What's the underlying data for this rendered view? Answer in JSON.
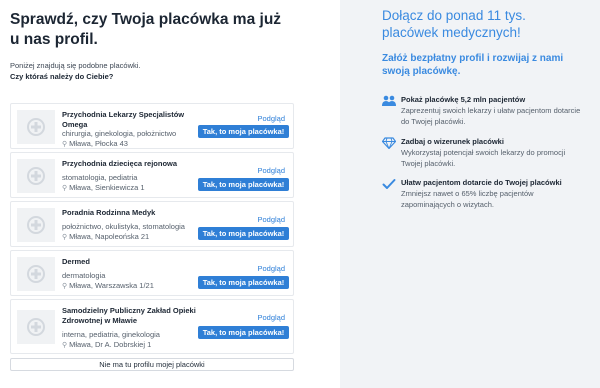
{
  "heading": "Sprawdź, czy Twoja placówka ma już u nas profil.",
  "intro": "Poniżej znajdują się podobne placówki.",
  "question": "Czy któraś należy do Ciebie?",
  "preview_label": "Podgląd",
  "claim_label": "Tak, to moja placówka!",
  "clinics": [
    {
      "name": "Przychodnia Lekarzy Specjalistów Omega",
      "specialties": "chirurgia, ginekologia, położnictwo",
      "address": "Mława, Płocka 43"
    },
    {
      "name": "Przychodnia dziecięca rejonowa",
      "specialties": "stomatologia, pediatria",
      "address": "Mława, Sienkiewicza 1"
    },
    {
      "name": "Poradnia Rodzinna Medyk",
      "specialties": "położnictwo, okulistyka, stomatologia",
      "address": "Mława, Napoleońska 21"
    },
    {
      "name": "Dermed",
      "specialties": "dermatologia",
      "address": "Mława, Warszawska 1/21"
    },
    {
      "name": "Samodzielny Publiczny Zakład Opieki Zdrowotnej w Mławie",
      "specialties": "interna, pediatria, ginekologia",
      "address": "Mława, Dr A. Dobrskiej 1"
    }
  ],
  "no_profile_label": "Nie ma tu profilu mojej placówki",
  "promo": {
    "title": "Dołącz do ponad 11 tys. placówek medycznych!",
    "subtitle": "Załóż bezpłatny profil i rozwijaj z nami swoją placówkę.",
    "features": [
      {
        "icon": "users-icon",
        "title": "Pokaż placówkę 5,2 mln pacjentów",
        "desc": "Zaprezentuj swoich lekarzy i ułatw pacjentom dotarcie do Twojej placówki."
      },
      {
        "icon": "diamond-icon",
        "title": "Zadbaj o wizerunek placówki",
        "desc": "Wykorzystaj potencjał swoich lekarzy do promocji Twojej placówki."
      },
      {
        "icon": "check-icon",
        "title": "Ułatw pacjentom dotarcie do Twojej placówki",
        "desc": "Zmniejsz nawet o 65% liczbę pacjentów zapominających o wizytach."
      }
    ]
  },
  "colors": {
    "accent": "#2f7fd6",
    "promo_text": "#3a8ae0",
    "panel_bg": "#f1f3f6"
  }
}
